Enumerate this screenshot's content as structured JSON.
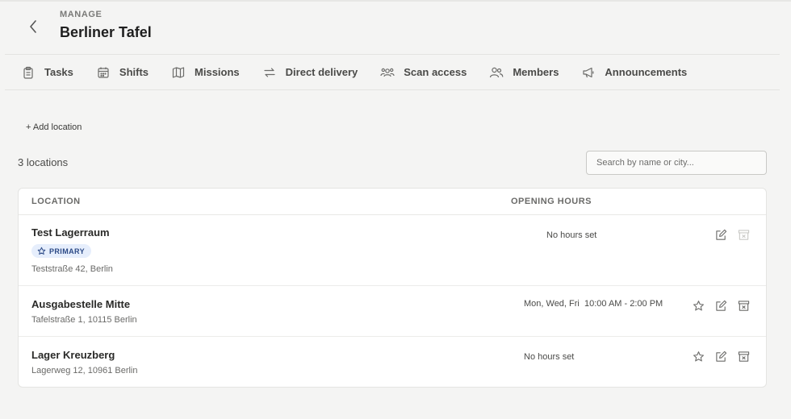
{
  "header": {
    "eyebrow": "MANAGE",
    "title": "Berliner Tafel"
  },
  "tabs": [
    {
      "label": "Tasks",
      "icon": "clipboard-icon"
    },
    {
      "label": "Shifts",
      "icon": "calendar-icon"
    },
    {
      "label": "Missions",
      "icon": "map-icon"
    },
    {
      "label": "Direct delivery",
      "icon": "arrows-swap-icon"
    },
    {
      "label": "Scan access",
      "icon": "group-icon"
    },
    {
      "label": "Members",
      "icon": "users-icon"
    },
    {
      "label": "Announcements",
      "icon": "megaphone-icon"
    }
  ],
  "toolbar": {
    "add_location_label": "+ Add location",
    "count_label": "3 locations",
    "search_placeholder": "Search by name or city..."
  },
  "table": {
    "columns": {
      "location": "LOCATION",
      "hours": "OPENING HOURS"
    },
    "rows": [
      {
        "name": "Test Lagerraum",
        "badge": "PRIMARY",
        "address": "Teststraße 42, Berlin",
        "hours": "No hours set"
      },
      {
        "name": "Ausgabestelle Mitte",
        "address": "Tafelstraße 1, 10115 Berlin",
        "hours": "Mon, Wed, Fri  10:00 AM - 2:00 PM"
      },
      {
        "name": "Lager Kreuzberg",
        "address": "Lagerweg 12, 10961 Berlin",
        "hours": "No hours set"
      }
    ]
  },
  "colors": {
    "background": "#f4f4f3",
    "card": "#ffffff",
    "badge_bg": "#e6eefc",
    "badge_text": "#2c4a86",
    "icon": "#6b6b69"
  }
}
